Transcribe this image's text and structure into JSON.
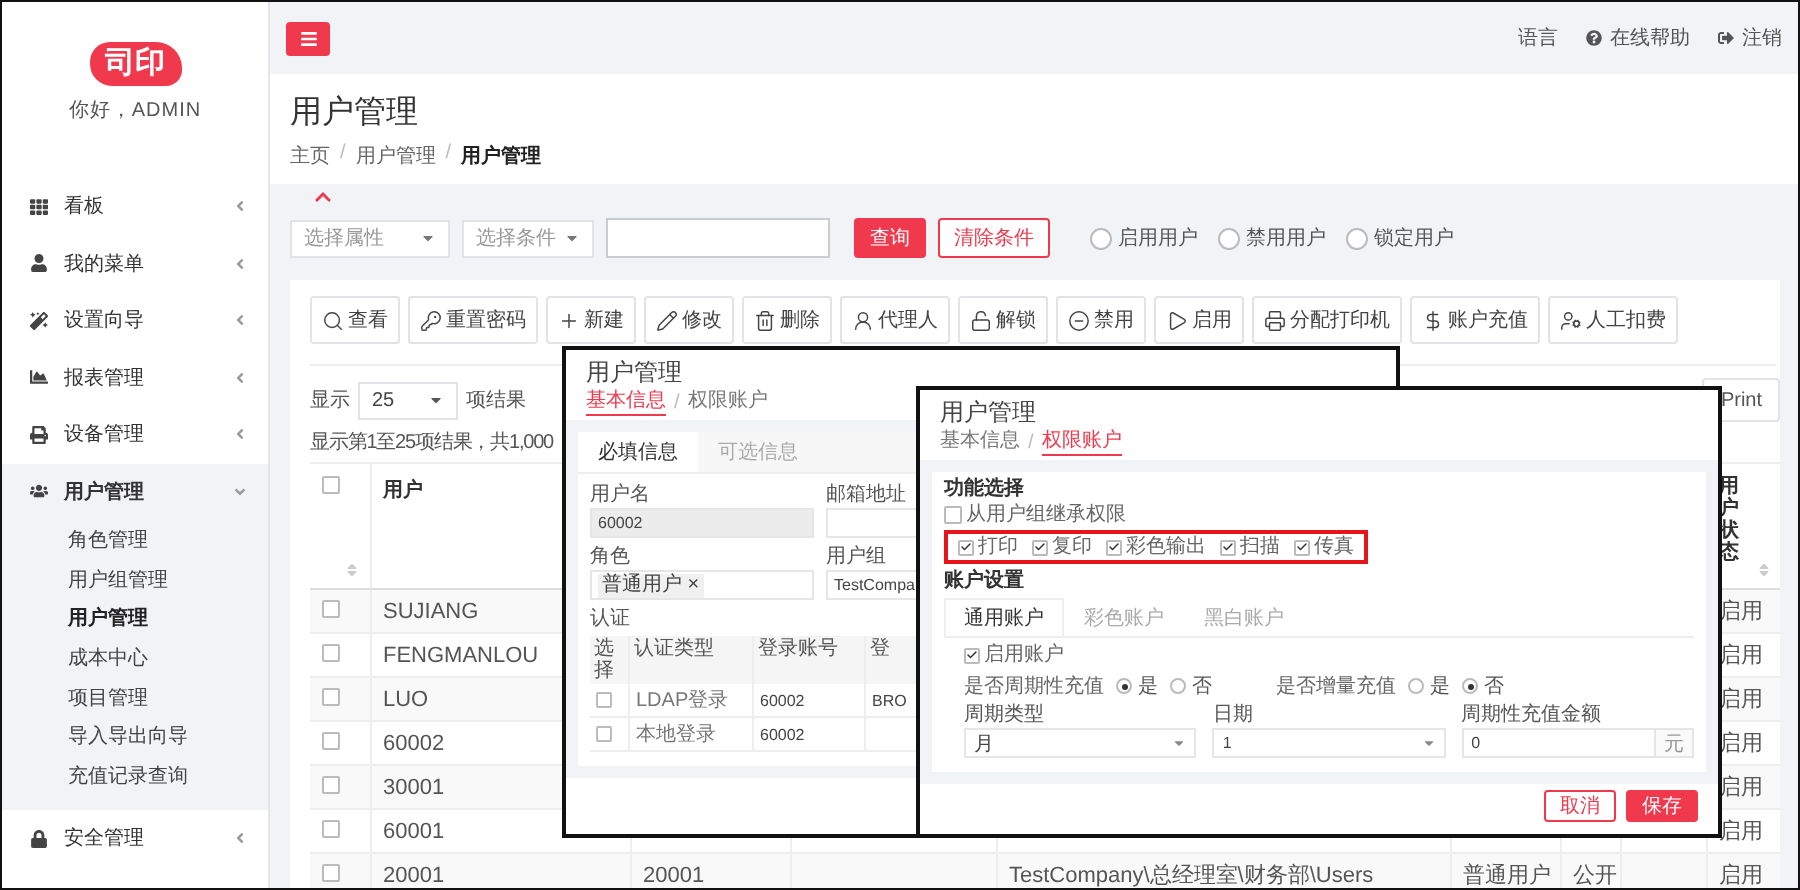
{
  "sidebar": {
    "logo": "司印",
    "greeting": "你好，ADMIN",
    "items": [
      {
        "label": "看板",
        "expanded": false
      },
      {
        "label": "我的菜单",
        "expanded": false
      },
      {
        "label": "设置向导",
        "expanded": false
      },
      {
        "label": "报表管理",
        "expanded": false
      },
      {
        "label": "设备管理",
        "expanded": false
      },
      {
        "label": "用户管理",
        "expanded": true,
        "children": [
          {
            "label": "角色管理",
            "selected": false
          },
          {
            "label": "用户组管理",
            "selected": false
          },
          {
            "label": "用户管理",
            "selected": true
          },
          {
            "label": "成本中心",
            "selected": false
          },
          {
            "label": "项目管理",
            "selected": false
          },
          {
            "label": "导入导出向导",
            "selected": false
          },
          {
            "label": "充值记录查询",
            "selected": false
          }
        ]
      },
      {
        "label": "安全管理",
        "expanded": false
      }
    ]
  },
  "header": {
    "language": "语言",
    "help": "在线帮助",
    "logout": "注销"
  },
  "page": {
    "title": "用户管理",
    "separator": "/",
    "breadcrumb": [
      "主页",
      "用户管理",
      "用户管理"
    ]
  },
  "filter": {
    "selects": [
      {
        "placeholder": "选择属性"
      },
      {
        "placeholder": "选择条件"
      }
    ],
    "buttons": [
      {
        "label": "查询",
        "kind": "primary"
      },
      {
        "label": "清除条件",
        "kind": "outline"
      }
    ],
    "radios": [
      {
        "label": "启用用户",
        "selected": false
      },
      {
        "label": "禁用用户",
        "selected": false
      },
      {
        "label": "锁定用户",
        "selected": false
      }
    ]
  },
  "toolbar": [
    "查看",
    "重置密码",
    "新建",
    "修改",
    "删除",
    "代理人",
    "解锁",
    "禁用",
    "启用",
    "分配打印机",
    "账户充值",
    "人工扣费"
  ],
  "length": {
    "prefix": "显示",
    "value": "25",
    "suffix": "项结果"
  },
  "print": "Print",
  "info": "显示第1至25项结果，共1,000",
  "table": {
    "select_all": {
      "checked": false
    },
    "header": {
      "user": "用户",
      "status": "用户状态"
    },
    "rows": [
      {
        "checked": false,
        "user": "SUJIANG",
        "status": "启用"
      },
      {
        "checked": false,
        "user": "FENGMANLOU",
        "status": "启用"
      },
      {
        "checked": false,
        "user": "LUO",
        "status": "启用"
      },
      {
        "checked": false,
        "user": "60002",
        "status": "启用"
      },
      {
        "checked": false,
        "user": "30001",
        "status": "启用"
      },
      {
        "checked": false,
        "user": "60001",
        "status": "启用"
      },
      {
        "checked": false,
        "user": "20001",
        "column_2": "20001",
        "column_4": "TestCompany\\总经理室\\财务部\\Users",
        "column_5": "普通用户",
        "column_6": "公开",
        "status": "启用"
      }
    ]
  },
  "dialog_basic": {
    "title": "用户管理",
    "separator": "/",
    "tabs": [
      {
        "label": "基本信息",
        "selected": true
      },
      {
        "label": "权限账户",
        "selected": false
      }
    ],
    "subtabs": [
      {
        "label": "必填信息",
        "selected": true
      },
      {
        "label": "可选信息",
        "selected": false
      }
    ],
    "username": {
      "label": "用户名",
      "value": "60002",
      "disabled": true
    },
    "email": {
      "label": "邮箱地址"
    },
    "role": {
      "label": "角色",
      "tag": "普通用户 ×"
    },
    "group": {
      "label": "用户组",
      "value": "TestCompa"
    },
    "auth": {
      "label": "认证",
      "columns": [
        "选择",
        "认证类型",
        "登录账号",
        "登"
      ],
      "rows": [
        {
          "checked": false,
          "type": "LDAP登录",
          "account": "60002",
          "column_4": "BRO"
        },
        {
          "checked": false,
          "type": "本地登录",
          "account": "60002"
        }
      ]
    }
  },
  "dialog_permissions": {
    "title": "用户管理",
    "separator": "/",
    "tabs": [
      {
        "label": "基本信息",
        "selected": false
      },
      {
        "label": "权限账户",
        "selected": true
      }
    ],
    "section": "功能选择",
    "inherit": {
      "label": "从用户组继承权限",
      "checked": false
    },
    "functions_highlighted": true,
    "functions": [
      {
        "label": "打印",
        "checked": true
      },
      {
        "label": "复印",
        "checked": true
      },
      {
        "label": "彩色输出",
        "checked": true
      },
      {
        "label": "扫描",
        "checked": true
      },
      {
        "label": "传真",
        "checked": true
      }
    ],
    "account_section": "账户设置",
    "account_tabs": [
      {
        "label": "通用账户",
        "selected": true
      },
      {
        "label": "彩色账户",
        "selected": false
      },
      {
        "label": "黑白账户",
        "selected": false
      }
    ],
    "enable": {
      "label": "启用账户",
      "checked": true
    },
    "radio_groups": [
      {
        "label": "是否周期性充值",
        "options": [
          {
            "label": "是",
            "selected": true
          },
          {
            "label": "否",
            "selected": false
          }
        ]
      },
      {
        "label": "是否增量充值",
        "options": [
          {
            "label": "是",
            "selected": false
          },
          {
            "label": "否",
            "selected": true
          }
        ]
      }
    ],
    "period_type": {
      "label": "周期类型",
      "value": "月"
    },
    "date": {
      "label": "日期",
      "value": "1"
    },
    "amount": {
      "label": "周期性充值金额",
      "value": "0",
      "unit": "元"
    },
    "buttons": [
      {
        "label": "取消",
        "kind": "outline"
      },
      {
        "label": "保存",
        "kind": "primary"
      }
    ]
  }
}
